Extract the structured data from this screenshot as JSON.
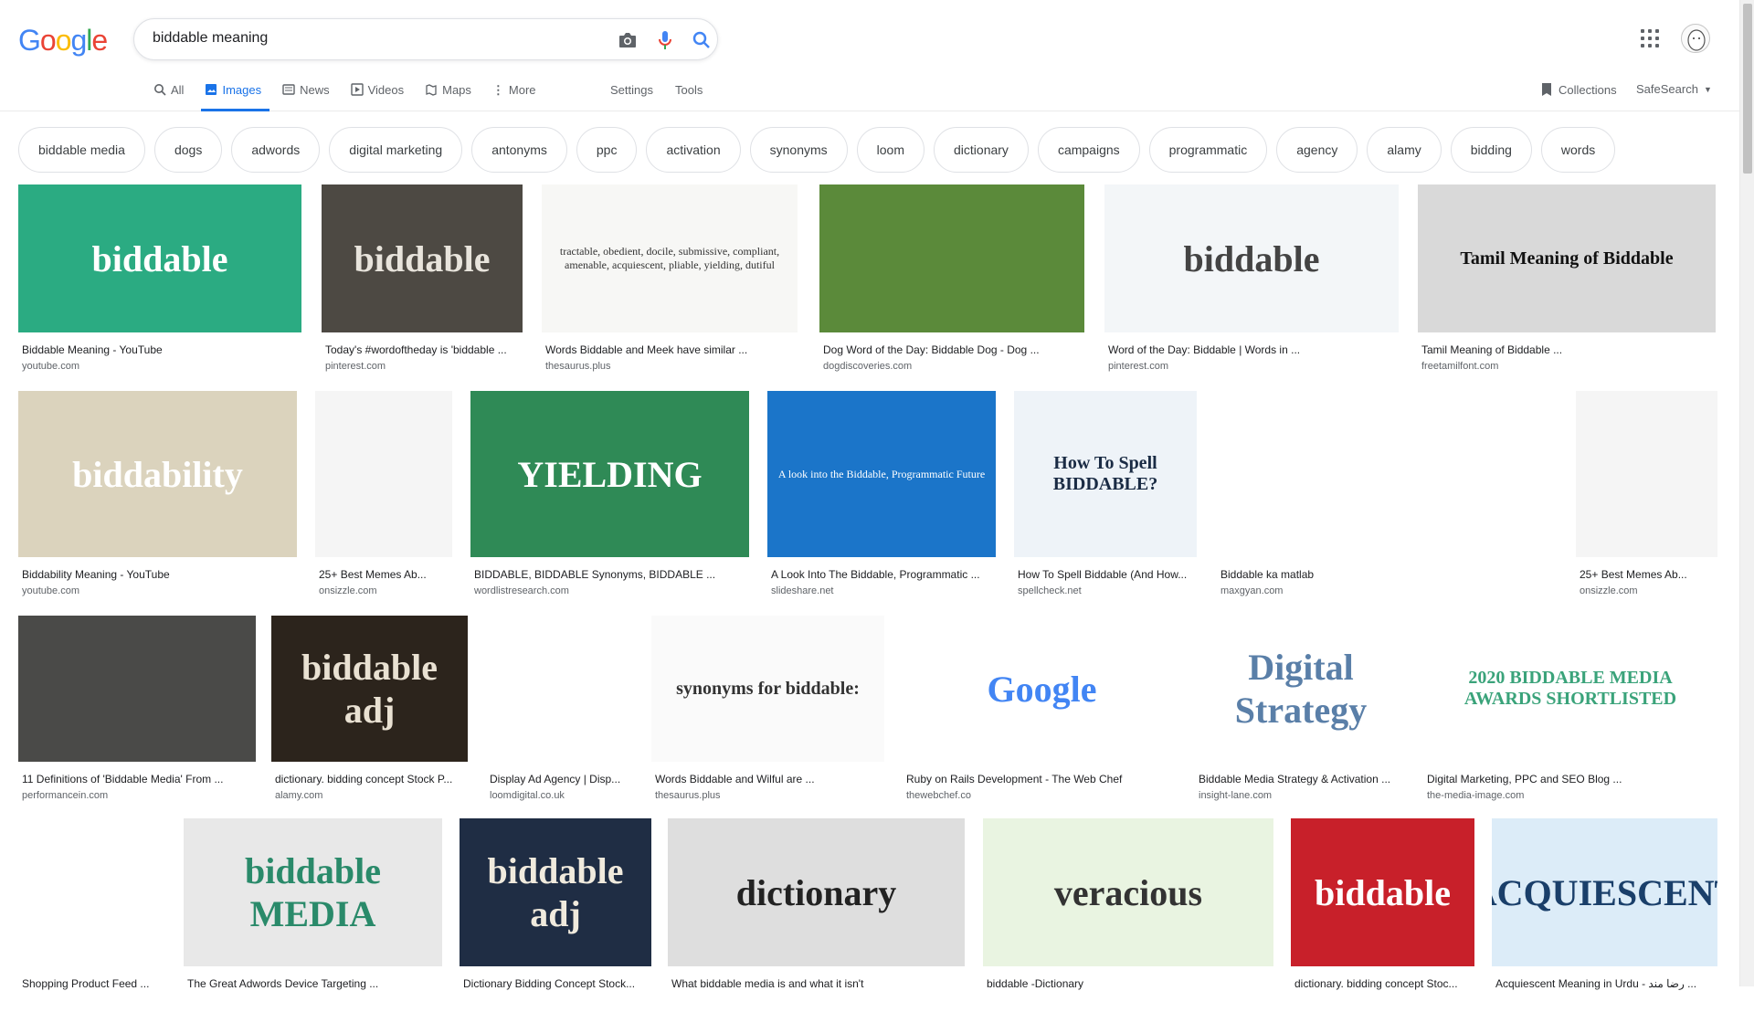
{
  "logo": {
    "text": "Google"
  },
  "search": {
    "value": "biddable meaning"
  },
  "tabs": [
    {
      "label": "All"
    },
    {
      "label": "Images"
    },
    {
      "label": "News"
    },
    {
      "label": "Videos"
    },
    {
      "label": "Maps"
    },
    {
      "label": "More"
    }
  ],
  "tools": {
    "settings": "Settings",
    "tools": "Tools"
  },
  "right": {
    "collections": "Collections",
    "safesearch": "SafeSearch"
  },
  "chips": [
    "biddable media",
    "dogs",
    "adwords",
    "digital marketing",
    "antonyms",
    "ppc",
    "activation",
    "synonyms",
    "loom",
    "dictionary",
    "campaigns",
    "programmatic",
    "agency",
    "alamy",
    "bidding",
    "words"
  ],
  "results": [
    {
      "caption": "Biddable Meaning - YouTube",
      "source": "youtube.com",
      "thumb_text": "biddable",
      "bg": "#2bab82",
      "fg": "#ffffff"
    },
    {
      "caption": "Today's #wordoftheday is 'biddable ...",
      "source": "pinterest.com",
      "thumb_text": "biddable",
      "bg": "#4d4943",
      "fg": "#e8e4dc"
    },
    {
      "caption": "Words Biddable and Meek have similar ...",
      "source": "thesaurus.plus",
      "thumb_text": "tractable, obedient, docile, submissive, compliant, amenable, acquiescent, pliable, yielding, dutiful",
      "bg": "#f7f7f5",
      "fg": "#333333"
    },
    {
      "caption": "Dog Word of the Day: Biddable Dog - Dog ...",
      "source": "dogdiscoveries.com",
      "thumb_text": "",
      "bg": "#5b8a3a",
      "fg": "#ffffff"
    },
    {
      "caption": "Word of the Day: Biddable | Words in ...",
      "source": "pinterest.com",
      "thumb_text": "biddable",
      "bg": "#f3f6f8",
      "fg": "#444444"
    },
    {
      "caption": "Tamil Meaning of Biddable ...",
      "source": "freetamilfont.com",
      "thumb_text": "Tamil Meaning of Biddable",
      "bg": "#d9d9d9",
      "fg": "#111111"
    },
    {
      "caption": "Biddability Meaning - YouTube",
      "source": "youtube.com",
      "thumb_text": "biddability",
      "bg": "#dbd3bd",
      "fg": "#ffffff"
    },
    {
      "caption": "25+ Best Memes Ab...",
      "source": "onsizzle.com",
      "thumb_text": "",
      "bg": "#f5f5f5",
      "fg": "#333333"
    },
    {
      "caption": "BIDDABLE, BIDDABLE Synonyms, BIDDABLE ...",
      "source": "wordlistresearch.com",
      "thumb_text": "YIELDING",
      "bg": "#2f8a56",
      "fg": "#ffffff"
    },
    {
      "caption": "A Look Into The Biddable, Programmatic ...",
      "source": "slideshare.net",
      "thumb_text": "A look into the Biddable, Programmatic Future",
      "bg": "#1b75c9",
      "fg": "#ffffff"
    },
    {
      "caption": "How To Spell Biddable (And How...",
      "source": "spellcheck.net",
      "thumb_text": "How To Spell BIDDABLE?",
      "bg": "#eef3f8",
      "fg": "#1a2b44"
    },
    {
      "caption": "Biddable ka matlab",
      "source": "maxgyan.com",
      "thumb_text": "",
      "bg": "#ffffff",
      "fg": "#2a61c4"
    },
    {
      "caption": "25+ Best Memes Ab...",
      "source": "onsizzle.com",
      "thumb_text": "",
      "bg": "#f5f5f5",
      "fg": "#333333"
    },
    {
      "caption": "11 Definitions of 'Biddable Media' From ...",
      "source": "performancein.com",
      "thumb_text": "",
      "bg": "#4a4a48",
      "fg": "#e8cf3a"
    },
    {
      "caption": "dictionary. bidding concept Stock P...",
      "source": "alamy.com",
      "thumb_text": "biddable adj",
      "bg": "#2c241c",
      "fg": "#e9e1d2"
    },
    {
      "caption": "Display Ad Agency | Disp...",
      "source": "loomdigital.co.uk",
      "thumb_text": "",
      "bg": "#ffffff",
      "fg": "#7b3fc4"
    },
    {
      "caption": "Words Biddable and Wilful are ...",
      "source": "thesaurus.plus",
      "thumb_text": "synonyms for biddable:",
      "bg": "#fafafa",
      "fg": "#333333"
    },
    {
      "caption": "Ruby on Rails Development - The Web Chef",
      "source": "thewebchef.co",
      "thumb_text": "Google",
      "bg": "#ffffff",
      "fg": "#4285f4"
    },
    {
      "caption": "Biddable Media Strategy & Activation ...",
      "source": "insight-lane.com",
      "thumb_text": "Digital Strategy",
      "bg": "#ffffff",
      "fg": "#5a7fa8"
    },
    {
      "caption": "Digital Marketing, PPC and SEO Blog ...",
      "source": "the-media-image.com",
      "thumb_text": "2020 BIDDABLE MEDIA AWARDS SHORTLISTED",
      "bg": "#ffffff",
      "fg": "#3aa37a"
    },
    {
      "caption": "Shopping Product Feed ...",
      "source": "",
      "thumb_text": "",
      "bg": "#ffffff",
      "fg": "#8a3fc8"
    },
    {
      "caption": "The Great Adwords Device Targeting ...",
      "source": "",
      "thumb_text": "biddable MEDIA",
      "bg": "#e8e8e8",
      "fg": "#2a8a6a"
    },
    {
      "caption": "Dictionary Bidding Concept Stock...",
      "source": "",
      "thumb_text": "biddable adj",
      "bg": "#1f2d44",
      "fg": "#f0eadd"
    },
    {
      "caption": "What biddable media is and what it isn't",
      "source": "",
      "thumb_text": "dictionary",
      "bg": "#dedede",
      "fg": "#222222"
    },
    {
      "caption": "biddable -Dictionary",
      "source": "",
      "thumb_text": "veracious",
      "bg": "#e9f4e1",
      "fg": "#333333"
    },
    {
      "caption": "dictionary. bidding concept Stoc...",
      "source": "",
      "thumb_text": "biddable",
      "bg": "#c8202a",
      "fg": "#ffffff"
    },
    {
      "caption": "Acquiescent Meaning in Urdu - رضا مند ...",
      "source": "",
      "thumb_text": "ACQUIESCENT",
      "bg": "#dcecf8",
      "fg": "#1a3f6a"
    }
  ]
}
